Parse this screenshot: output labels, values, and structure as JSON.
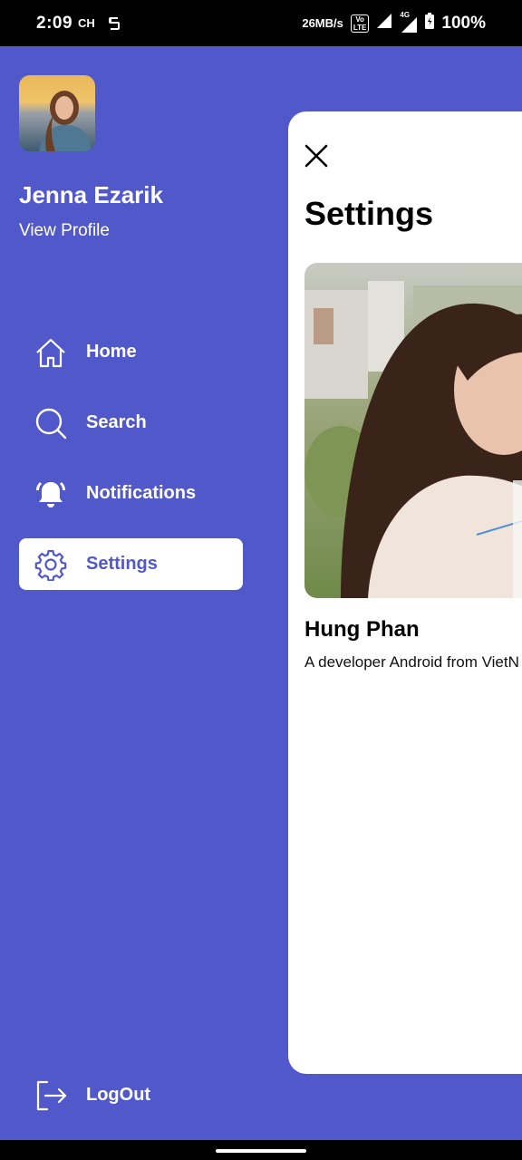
{
  "status_bar": {
    "time": "2:09",
    "ampm": "CH",
    "speed": "26MB/s",
    "network": "4G",
    "volte": "VoLTE",
    "battery": "100%"
  },
  "drawer": {
    "user_name": "Jenna Ezarik",
    "view_profile": "View Profile",
    "menu": [
      {
        "label": "Home",
        "icon": "home-icon",
        "active": false
      },
      {
        "label": "Search",
        "icon": "search-icon",
        "active": false
      },
      {
        "label": "Notifications",
        "icon": "bell-icon",
        "active": false
      },
      {
        "label": "Settings",
        "icon": "gear-icon",
        "active": true
      }
    ],
    "logout": "LogOut"
  },
  "panel": {
    "title": "Settings",
    "card_name": "Hung Phan",
    "card_desc": "A developer Android from VietN"
  },
  "colors": {
    "accent": "#5158C9",
    "panel_bg": "#FFFFFF"
  }
}
